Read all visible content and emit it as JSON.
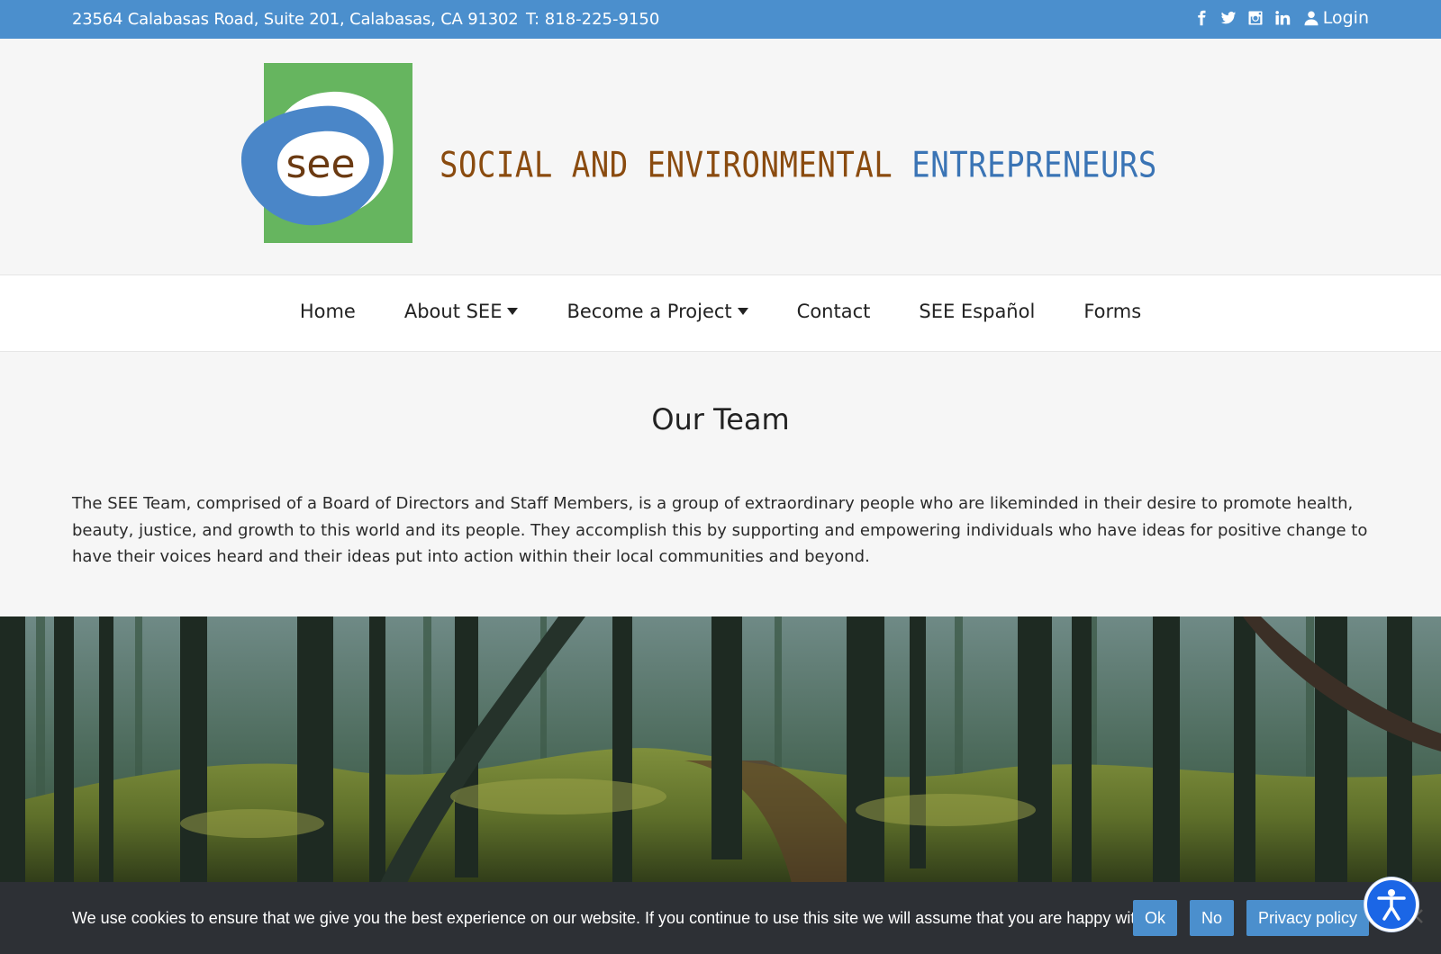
{
  "topbar": {
    "address": "23564 Calabasas Road, Suite 201, Calabasas, CA 91302",
    "phone": "T: 818-225-9150",
    "social": [
      "facebook-icon",
      "twitter-icon",
      "instagram-icon",
      "linkedin-icon"
    ],
    "login_label": "Login"
  },
  "logo": {
    "mark_text": "see",
    "title_part1": "SOCIAL AND ENVIRONMENTAL",
    "title_part2": "ENTREPRENEURS",
    "colors": {
      "green": "#66b55f",
      "blue": "#4a86c8",
      "brown": "#8a4b0f",
      "title_blue": "#3a74b5"
    }
  },
  "nav": {
    "items": [
      {
        "label": "Home"
      },
      {
        "label": "About SEE"
      },
      {
        "label": "Become a Project"
      },
      {
        "label": "Contact"
      },
      {
        "label": "SEE Español"
      },
      {
        "label": "Forms"
      }
    ]
  },
  "main": {
    "title": "Our Team",
    "intro": "The SEE Team, comprised of a Board of Directors and Staff Members, is a group of extraordinary people who are likeminded in their desire to promote health, beauty, justice, and growth to this world and its people. They accomplish this by supporting and empowering individuals who have ideas for positive change to have their voices heard and their ideas put into action within their local communities and beyond."
  },
  "cookie": {
    "message": "We use cookies to ensure that we give you the best experience on our website. If you continue to use this site we will assume that you are happy with it.",
    "ok_label": "Ok",
    "no_label": "No",
    "privacy_label": "Privacy policy"
  },
  "colors": {
    "topbar": "#4b8fcd",
    "cookie_bg": "#2d3035",
    "button": "#4b8fcd",
    "a11y": "#1b66e6"
  }
}
